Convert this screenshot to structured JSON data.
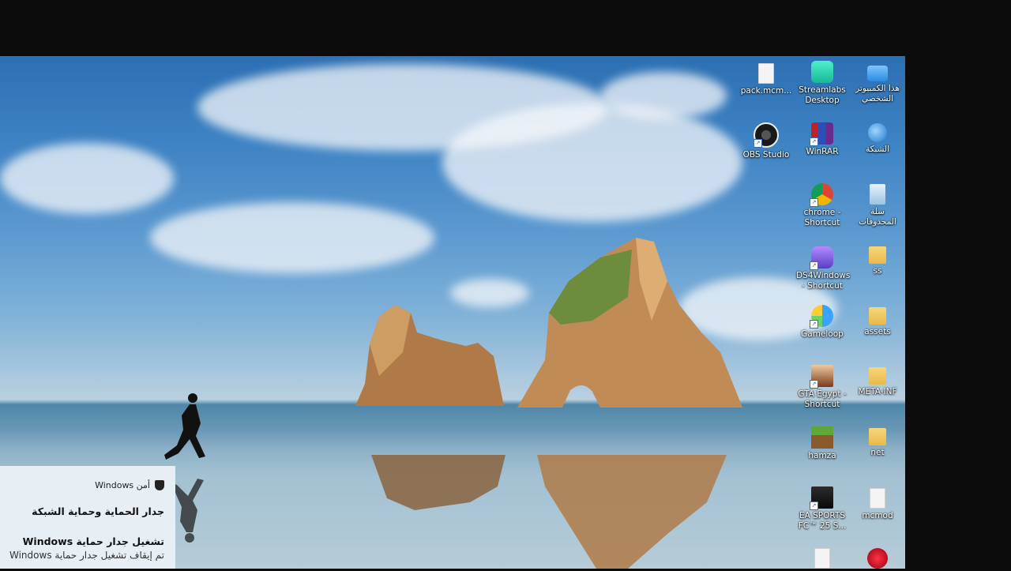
{
  "desktop": {
    "icons": [
      {
        "label": "هذا الكمبيوتر الشخصي",
        "icon": "computer-icon"
      },
      {
        "label": "Streamlabs Desktop",
        "icon": "streamlabs-icon"
      },
      {
        "label": "pack.mcm...",
        "icon": "file-icon"
      },
      {
        "label": "الشبكة",
        "icon": "network-icon"
      },
      {
        "label": "WinRAR",
        "icon": "winrar-icon"
      },
      {
        "label": "OBS Studio",
        "icon": "obs-icon"
      },
      {
        "label": "سلة المحذوفات",
        "icon": "recycle-bin-icon"
      },
      {
        "label": "chrome - Shortcut",
        "icon": "chrome-icon"
      },
      {
        "label": "ss",
        "icon": "folder-icon"
      },
      {
        "label": "DS4Windows - Shortcut",
        "icon": "ds4windows-icon"
      },
      {
        "label": "assets",
        "icon": "folder-icon"
      },
      {
        "label": "Gameloop",
        "icon": "gameloop-icon"
      },
      {
        "label": "META-INF",
        "icon": "folder-icon"
      },
      {
        "label": "GTA Egypt - Shortcut",
        "icon": "gta-icon"
      },
      {
        "label": "net",
        "icon": "folder-icon"
      },
      {
        "label": "hamza",
        "icon": "minecraft-icon"
      },
      {
        "label": "mcmod",
        "icon": "file-icon"
      },
      {
        "label": "EA SPORTS FC™ 25 S...",
        "icon": "ea-fc-icon"
      }
    ]
  },
  "notification": {
    "app": "أمن Windows",
    "title": "جدار الحماية وحماية الشبكة",
    "subtitle": "تشغيل جدار حماية Windows",
    "body": "تم إيقاف تشغيل جدار حماية Windows"
  },
  "colors": {
    "sky_top": "#2c6fb3",
    "toast_bg": "#e7eef4",
    "letterbox": "#0c0c0c"
  }
}
